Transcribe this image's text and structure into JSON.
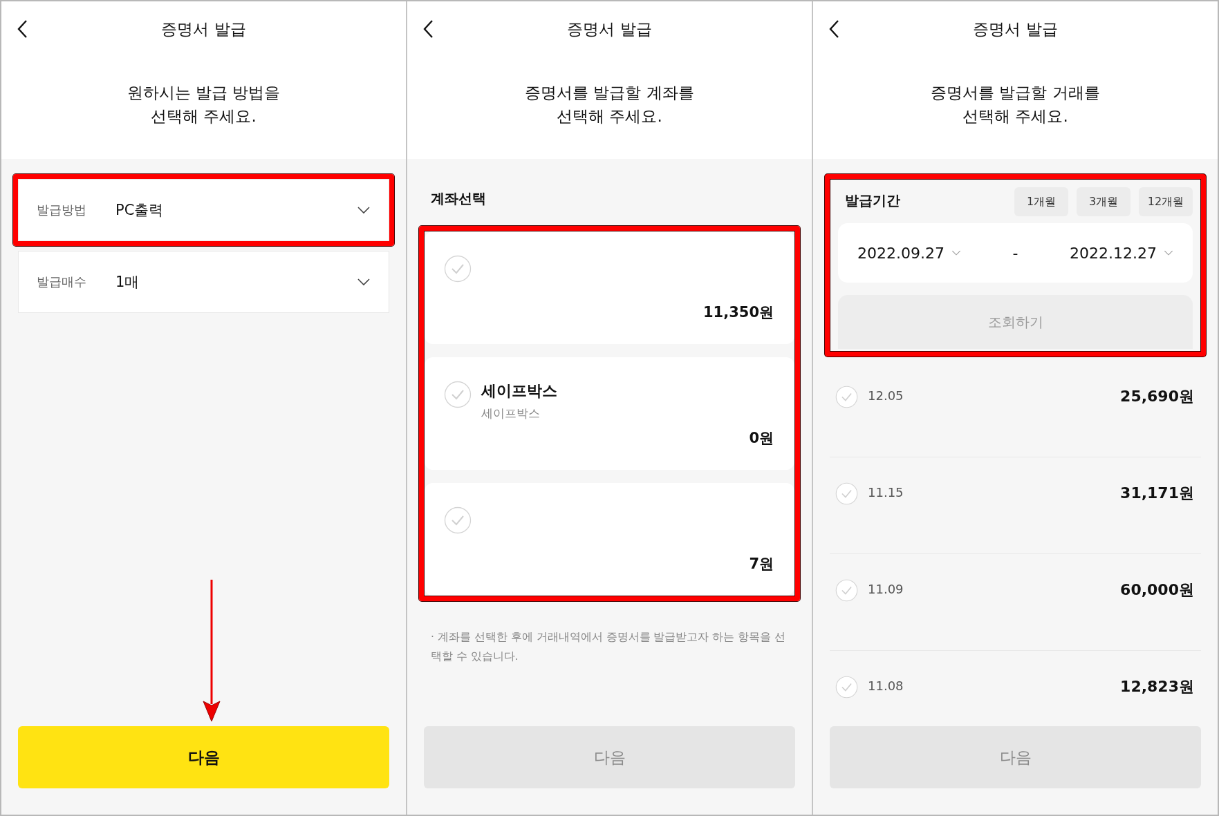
{
  "screens": [
    {
      "kind": "method",
      "title": "증명서 발급",
      "prompt": "원하시는 발급 방법을\n선택해 주세요.",
      "fields": [
        {
          "label": "발급방법",
          "value": "PC출력",
          "highlighted": true
        },
        {
          "label": "발급매수",
          "value": "1매",
          "highlighted": false
        }
      ],
      "arrow_to_next": true,
      "next_button": {
        "label": "다음",
        "disabled": false
      }
    },
    {
      "kind": "account",
      "title": "증명서 발급",
      "prompt": "증명서를 발급할 계좌를\n선택해 주세요.",
      "section_title": "계좌선택",
      "accounts_highlighted": true,
      "accounts": [
        {
          "balance": "11,350원",
          "selected": false
        },
        {
          "name": "세이프박스",
          "subtitle": "세이프박스",
          "balance": "0원",
          "selected": false
        },
        {
          "balance": "7원",
          "selected": false
        }
      ],
      "note": "· 계좌를 선택한 후에 거래내역에서 증명서를 발급받고자 하는 항목을 선택할 수 있습니다.",
      "next_button": {
        "label": "다음",
        "disabled": true
      }
    },
    {
      "kind": "transaction",
      "title": "증명서 발급",
      "prompt": "증명서를 발급할 거래를\n선택해 주세요.",
      "period": {
        "label": "발급기간",
        "highlighted": true,
        "presets": [
          {
            "label": "1개월",
            "selected": false
          },
          {
            "label": "3개월",
            "selected": false
          },
          {
            "label": "12개월",
            "selected": false
          }
        ],
        "start": "2022.09.27",
        "separator": "-",
        "end": "2022.12.27",
        "search_button": {
          "label": "조회하기",
          "disabled": true
        }
      },
      "transactions": [
        {
          "date": "12.05",
          "amount": "25,690원",
          "selected": false
        },
        {
          "date": "11.15",
          "amount": "31,171원",
          "selected": false
        },
        {
          "date": "11.09",
          "amount": "60,000원",
          "selected": false
        },
        {
          "date": "11.08",
          "amount": "12,823원",
          "selected": false
        }
      ],
      "next_button": {
        "label": "다음",
        "disabled": true
      }
    }
  ]
}
